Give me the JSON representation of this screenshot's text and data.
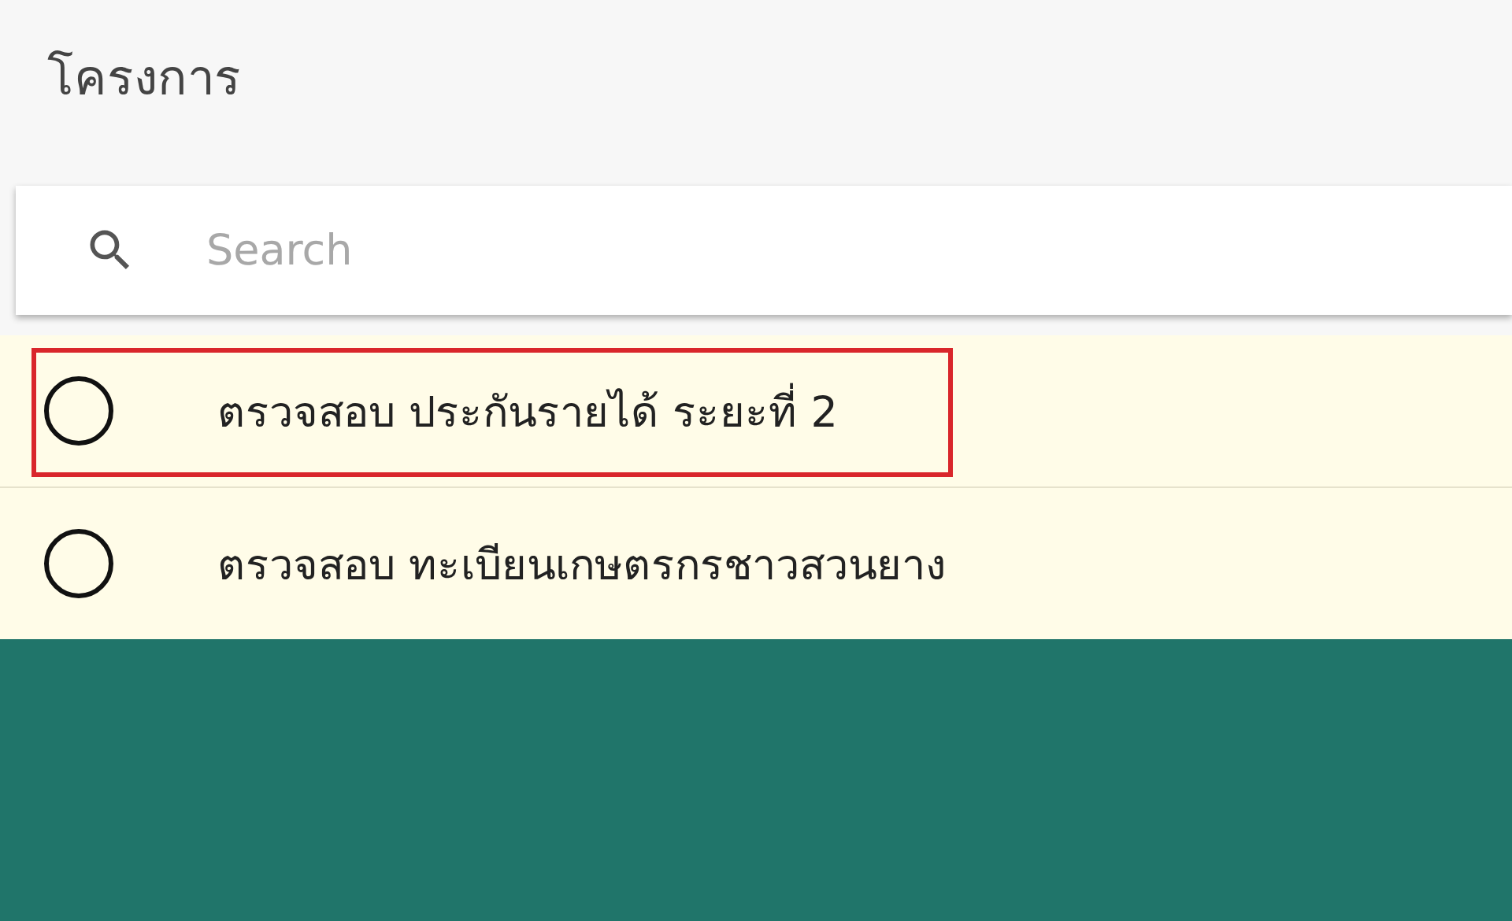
{
  "header": {
    "title": "โครงการ"
  },
  "search": {
    "placeholder": "Search"
  },
  "projects": [
    {
      "label": "ตรวจสอบ ประกันรายได้ ระยะที่ 2",
      "selected": false,
      "highlighted": true
    },
    {
      "label": "ตรวจสอบ ทะเบียนเกษตรกรชาวสวนยาง",
      "selected": false,
      "highlighted": false
    }
  ]
}
